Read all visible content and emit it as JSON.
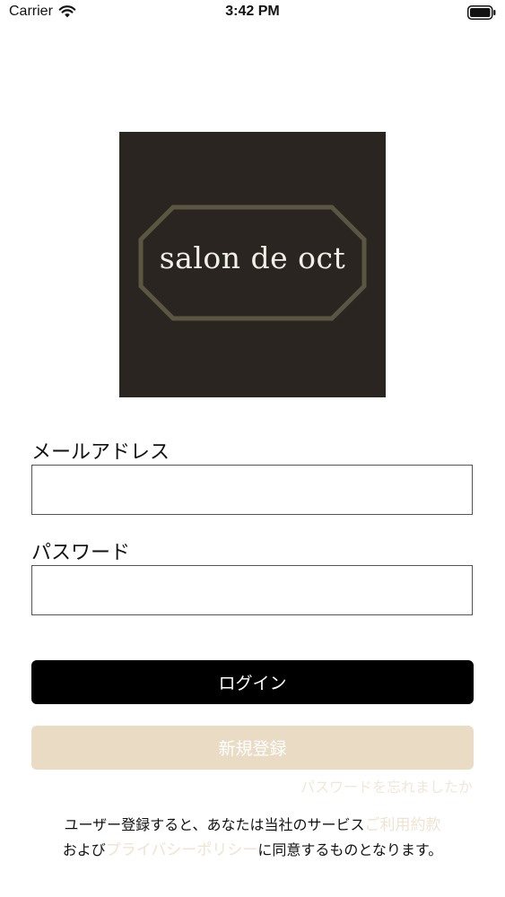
{
  "status_bar": {
    "carrier": "Carrier",
    "time": "3:42 PM"
  },
  "logo": {
    "text": "salon de oct",
    "colors": {
      "background": "#2a2520",
      "frame": "#5a5642",
      "text": "#f2efe8"
    }
  },
  "form": {
    "email_label": "メールアドレス",
    "email_value": "",
    "password_label": "パスワード",
    "password_value": ""
  },
  "buttons": {
    "login_label": "ログイン",
    "register_label": "新規登録",
    "forgot_label": "パスワードを忘れましたか"
  },
  "terms": {
    "line1_prefix": "ユーザー登録すると、あなたは当社のサービス",
    "terms_link": "ご利用約款",
    "line2_prefix": "および",
    "privacy_link": "プライバシーポリシー",
    "line2_suffix": "に同意するものとなります。"
  },
  "colors": {
    "accent_beige": "#eadbc4",
    "link_beige": "#efe3d2",
    "primary_black": "#000000"
  },
  "icons": {
    "wifi": "wifi-icon",
    "battery": "battery-icon"
  }
}
